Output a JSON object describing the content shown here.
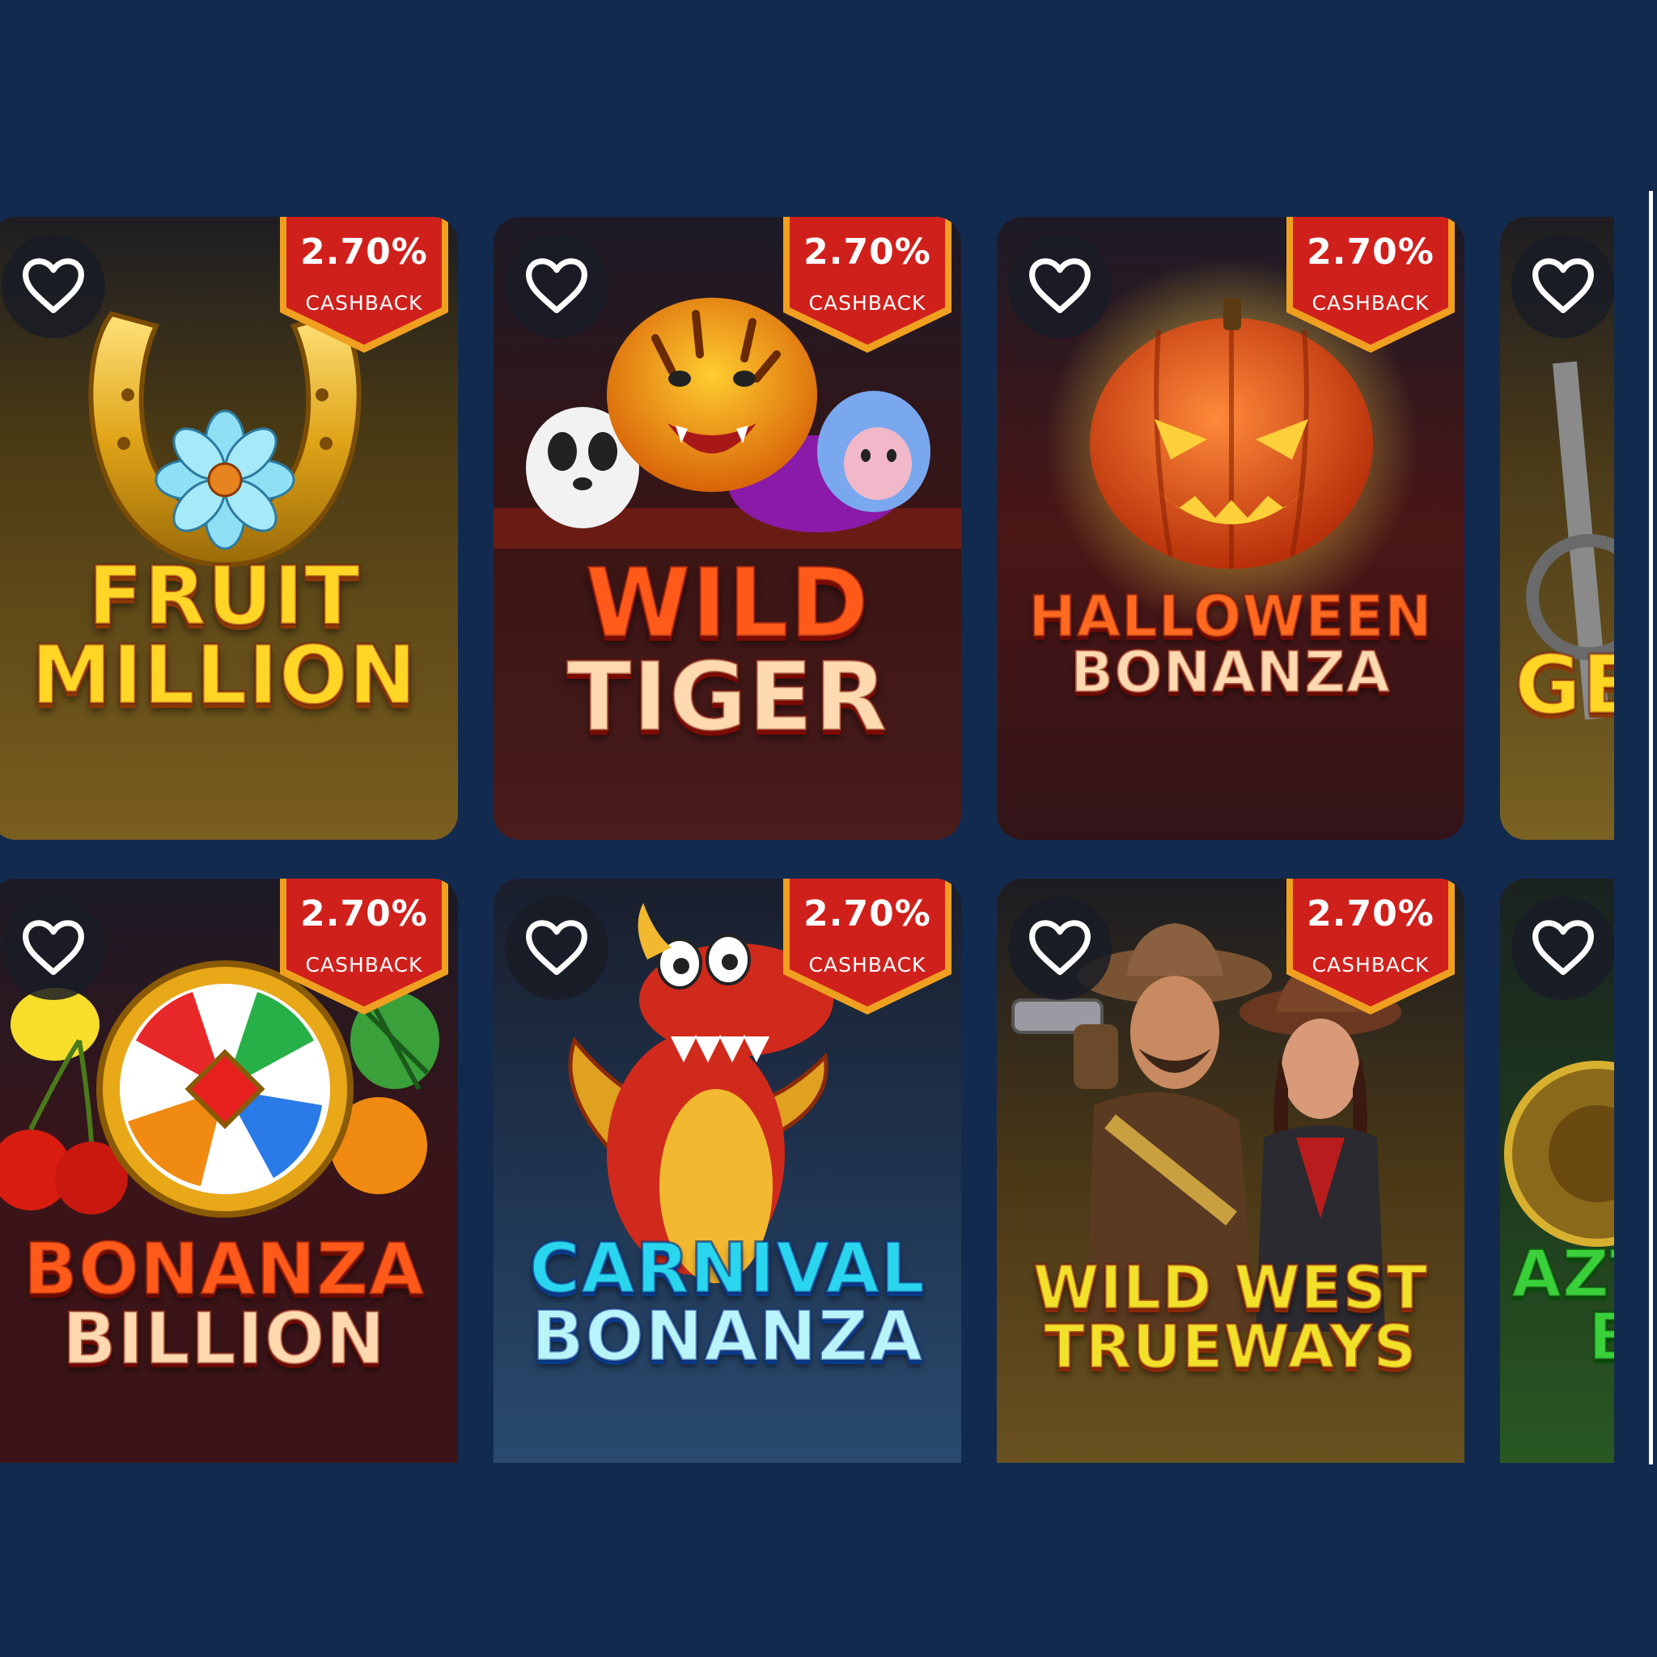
{
  "games": [
    {
      "title_line1": "FRUIT",
      "title_line2": "MILLION",
      "cashback_percent": "2.70%",
      "cashback_label": "CASHBACK"
    },
    {
      "title_line1": "WILD",
      "title_line2": "TIGER",
      "cashback_percent": "2.70%",
      "cashback_label": "CASHBACK"
    },
    {
      "title_line1": "HALLOWEEN",
      "title_line2": "BONANZA",
      "cashback_percent": "2.70%",
      "cashback_label": "CASHBACK"
    },
    {
      "title_line1": "GE",
      "title_line2": ""
    },
    {
      "title_line1": "BONANZA",
      "title_line2": "BILLION",
      "cashback_percent": "2.70%",
      "cashback_label": "CASHBACK"
    },
    {
      "title_line1": "CARNIVAL",
      "title_line2": "BONANZA",
      "cashback_percent": "2.70%",
      "cashback_label": "CASHBACK"
    },
    {
      "title_line1": "WILD WEST",
      "title_line2": "TRUEWAYS",
      "cashback_percent": "2.70%",
      "cashback_label": "CASHBACK"
    },
    {
      "title_line1": "AZT",
      "title_line2": "B"
    }
  ],
  "colors": {
    "page_background": "#132a4f",
    "badge_red": "#d0201c",
    "badge_gold": "#f0a020",
    "heart_white": "#ffffff"
  },
  "icons": {
    "favorite": "heart-outline-icon",
    "cashback": "cashback-ribbon-badge"
  }
}
